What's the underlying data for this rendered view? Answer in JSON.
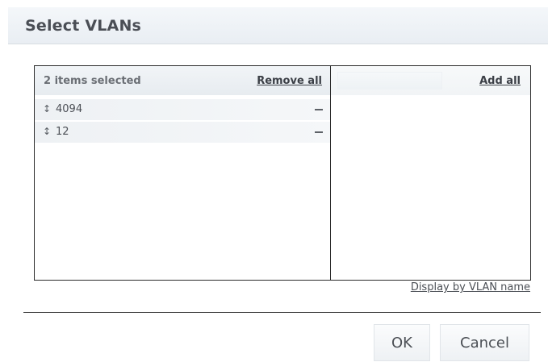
{
  "dialog": {
    "title": "Select VLANs"
  },
  "selected_pane": {
    "count_label": "2 items selected",
    "remove_all_label": "Remove all",
    "items": [
      {
        "label": "4094",
        "handle_glyph": "↕",
        "remove_glyph": ""
      },
      {
        "label": "12",
        "handle_glyph": "↕",
        "remove_glyph": ""
      }
    ]
  },
  "available_pane": {
    "search_value": "",
    "search_placeholder": "",
    "add_all_label": "Add all"
  },
  "display_toggle_label": "Display by VLAN name",
  "footer": {
    "ok_label": "OK",
    "cancel_label": "Cancel"
  }
}
